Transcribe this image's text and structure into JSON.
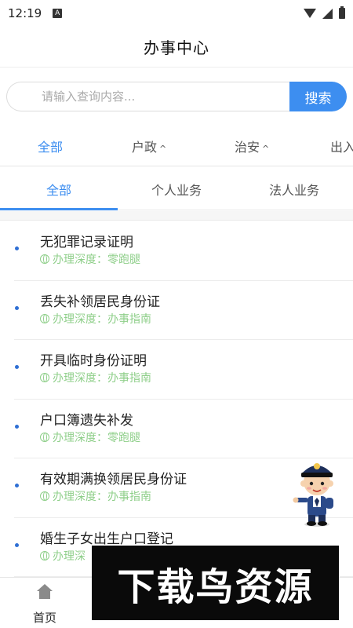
{
  "status": {
    "time": "12:19",
    "app_badge": "A"
  },
  "header": {
    "title": "办事中心"
  },
  "search": {
    "placeholder": "请输入查询内容...",
    "button_label": "搜索"
  },
  "categories": [
    {
      "label": "全部",
      "active": true,
      "caret": ""
    },
    {
      "label": "户政",
      "active": false,
      "caret": "^"
    },
    {
      "label": "治安",
      "active": false,
      "caret": "^"
    },
    {
      "label": "出入",
      "active": false,
      "caret": ""
    }
  ],
  "tabs": [
    {
      "label": "全部",
      "active": true
    },
    {
      "label": "个人业务",
      "active": false
    },
    {
      "label": "法人业务",
      "active": false
    }
  ],
  "services": [
    {
      "title": "无犯罪记录证明",
      "depth": "办理深度：零跑腿"
    },
    {
      "title": "丢失补领居民身份证",
      "depth": "办理深度：办事指南"
    },
    {
      "title": "开具临时身份证明",
      "depth": "办理深度：办事指南"
    },
    {
      "title": "户口簿遗失补发",
      "depth": "办理深度：零跑腿"
    },
    {
      "title": "有效期满换领居民身份证",
      "depth": "办理深度：办事指南"
    },
    {
      "title": "婚生子女出生户口登记",
      "depth": "办理深"
    }
  ],
  "bottom_nav": {
    "home_label": "首页"
  },
  "watermark": {
    "text": "下载鸟资源"
  },
  "colors": {
    "accent": "#3d8ef0",
    "depth_text": "#8fcf8a"
  }
}
